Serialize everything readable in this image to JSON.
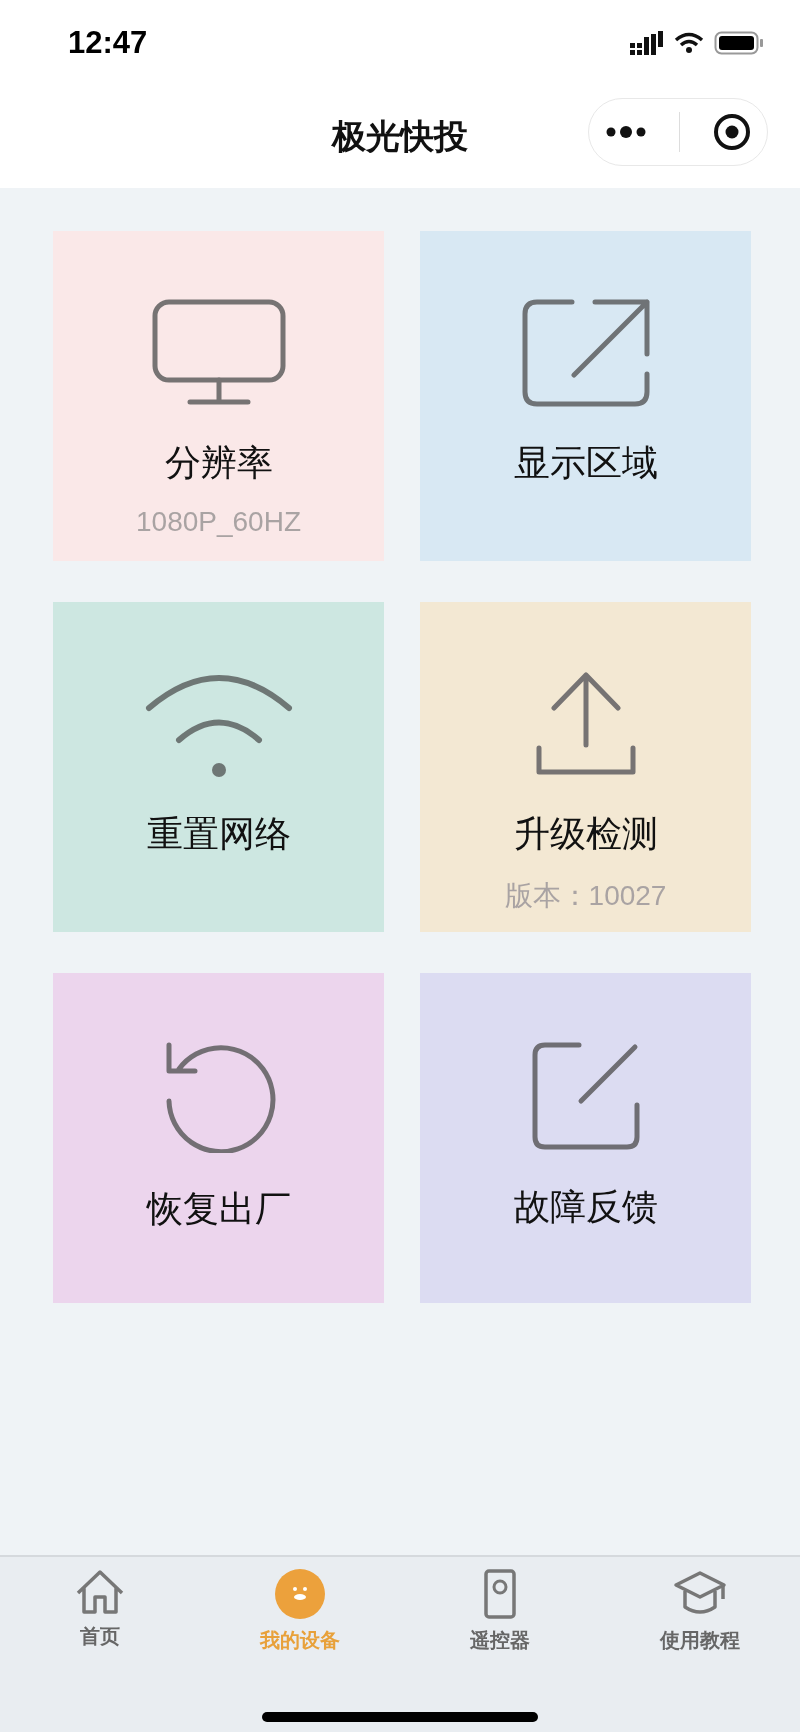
{
  "status_bar": {
    "time": "12:47"
  },
  "header": {
    "title": "极光快投"
  },
  "cards": [
    {
      "title": "分辨率",
      "subtitle": "1080P_60HZ",
      "color": "#fae8e8"
    },
    {
      "title": "显示区域",
      "color": "#d8e8f3"
    },
    {
      "title": "重置网络",
      "color": "#cde7e1"
    },
    {
      "title": "升级检测",
      "subtitle": "版本：10027",
      "color": "#f3e8d3"
    },
    {
      "title": "恢复出厂",
      "color": "#ecd5ed"
    },
    {
      "title": "故障反馈",
      "color": "#dcdcf2"
    }
  ],
  "tab_bar": [
    {
      "label": "首页",
      "selected": false
    },
    {
      "label": "我的设备",
      "selected": true
    },
    {
      "label": "遥控器",
      "selected": false
    },
    {
      "label": "使用教程",
      "selected": false
    }
  ]
}
